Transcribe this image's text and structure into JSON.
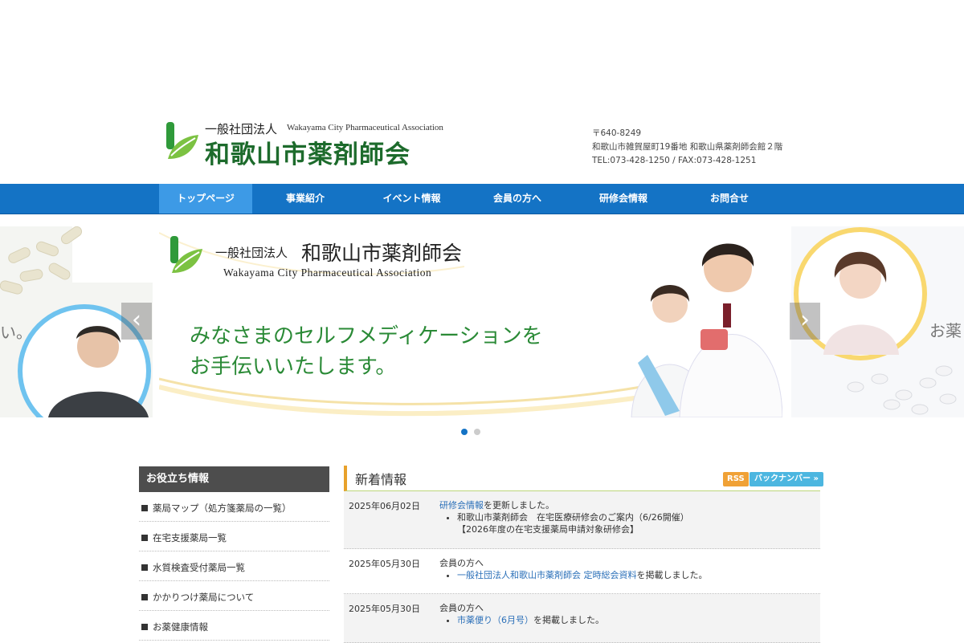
{
  "header": {
    "logo_small": "一般社団法人",
    "logo_en": "Wakayama City Pharmaceutical Association",
    "logo_big": "和歌山市薬剤師会",
    "postal": "〒640-8249",
    "address": "和歌山市雑賀屋町19番地 和歌山県薬剤師会館２階",
    "phone": "TEL:073-428-1250 / FAX:073-428-1251"
  },
  "nav": {
    "items": [
      {
        "label": "トップページ"
      },
      {
        "label": "事業紹介"
      },
      {
        "label": "イベント情報"
      },
      {
        "label": "会員の方へ"
      },
      {
        "label": "研修会情報"
      },
      {
        "label": "お問合せ"
      }
    ]
  },
  "slider": {
    "banner_small": "一般社団法人",
    "banner_big": "和歌山市薬剤師会",
    "banner_en": "Wakayama City Pharmaceutical Association",
    "tagline_1": "みなさまのセルフメディケーションを",
    "tagline_2": "お手伝いいたします。",
    "side_left_text": "い。",
    "side_right_text": "お薬",
    "prev": "‹",
    "next": "›"
  },
  "sidebar": {
    "title": "お役立ち情報",
    "items": [
      {
        "label": "薬局マップ（処方箋薬局の一覧）"
      },
      {
        "label": "在宅支援薬局一覧"
      },
      {
        "label": "水質検査受付薬局一覧"
      },
      {
        "label": "かかりつけ薬局について"
      },
      {
        "label": "お薬健康情報"
      }
    ]
  },
  "news": {
    "title": "新着情報",
    "rss": "RSS",
    "backnumber": "バックナンバー »",
    "rows": [
      {
        "date": "2025年06月02日",
        "link": "研修会情報",
        "text": "を更新しました。",
        "bullet": "和歌山市薬剤師会　在宅医療研修会のご案内（6/26開催）",
        "bullet2": "【2026年度の在宅支援薬局申請対象研修会】"
      },
      {
        "date": "2025年05月30日",
        "text": "会員の方へ",
        "bullet_link": "一般社団法人和歌山市薬剤師会 定時総会資料",
        "bullet_text": "を掲載しました。"
      },
      {
        "date": "2025年05月30日",
        "text": "会員の方へ",
        "bullet_link": "市薬便り（6月号）",
        "bullet_text": "を掲載しました。"
      }
    ]
  },
  "colors": {
    "nav_bg": "#1473c5",
    "nav_active": "#3d9ae6",
    "brand_green": "#1d6b2c",
    "accent_orange": "#e8a12b"
  }
}
